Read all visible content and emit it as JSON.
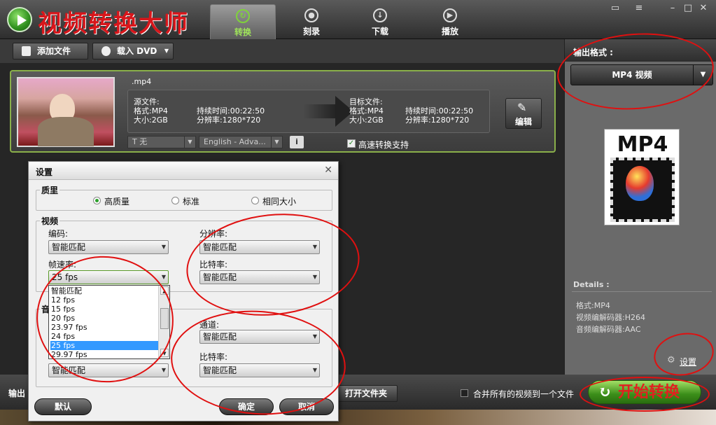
{
  "app": {
    "title": "视频转换大师"
  },
  "tabs": [
    {
      "label": "转换",
      "icon": "refresh-icon"
    },
    {
      "label": "刻录",
      "icon": "disc-icon"
    },
    {
      "label": "下载",
      "icon": "download-icon"
    },
    {
      "label": "播放",
      "icon": "play-icon"
    }
  ],
  "toolbar": {
    "add_file": "添加文件",
    "load_dvd": "载入 DVD"
  },
  "file": {
    "ext": ".mp4",
    "source_label": "源文件:",
    "source_format": "格式:MP4",
    "source_size": "大小:2GB",
    "source_duration": "持续时间:00:22:50",
    "source_resolution": "分辨率:1280*720",
    "target_label": "目标文件:",
    "target_format": "格式:MP4",
    "target_size": "大小:2GB",
    "target_duration": "持续时间:00:22:50",
    "target_resolution": "分辨率:1280*720",
    "edit_label": "编辑",
    "subtitle_value": "T 无",
    "audio_track_value": "English - Adva...",
    "info_label": "i",
    "high_speed_label": "高速转换支持"
  },
  "right_panel": {
    "output_format_title": "输出格式 :",
    "format_value": "MP4 视频",
    "badge_text": "MP4",
    "details_label": "Details :",
    "details": [
      "格式:MP4",
      "视频编解码器:H264",
      "音频编解码器:AAC"
    ],
    "settings_link": "设置"
  },
  "bottom": {
    "output_label": "输出",
    "open_folder": "打开文件夹",
    "merge_label": "合并所有的视频到一个文件",
    "start_label": "开始转换"
  },
  "dialog": {
    "title": "设置",
    "close": "✕",
    "quality_group": "质里",
    "quality_options": [
      "高质量",
      "标准",
      "相同大小"
    ],
    "video_group": "视频",
    "audio_group_partial": "音",
    "codec_label": "编码:",
    "codec_value": "智能匹配",
    "resolution_label": "分辨率:",
    "resolution_value": "智能匹配",
    "framerate_label": "帧速率:",
    "framerate_value": "25 fps",
    "video_bitrate_label": "比特率:",
    "video_bitrate_value": "智能匹配",
    "fps_options": [
      "智能匹配",
      "12 fps",
      "15 fps",
      "20 fps",
      "23.97 fps",
      "24 fps",
      "25 fps",
      "29.97 fps"
    ],
    "fps_selected_index": 6,
    "channel_label": "通道:",
    "channel_value": "智能匹配",
    "audio_codec_value": "智能匹配",
    "audio_bitrate_label": "比特率:",
    "audio_bitrate_value": "智能匹配",
    "default_btn": "默认",
    "ok_btn": "确定",
    "cancel_btn": "取消"
  },
  "colors": {
    "accent_green": "#7fd23a",
    "title_red": "#d8161b",
    "annotation_red": "#e01010",
    "selection_blue": "#3399ff"
  }
}
